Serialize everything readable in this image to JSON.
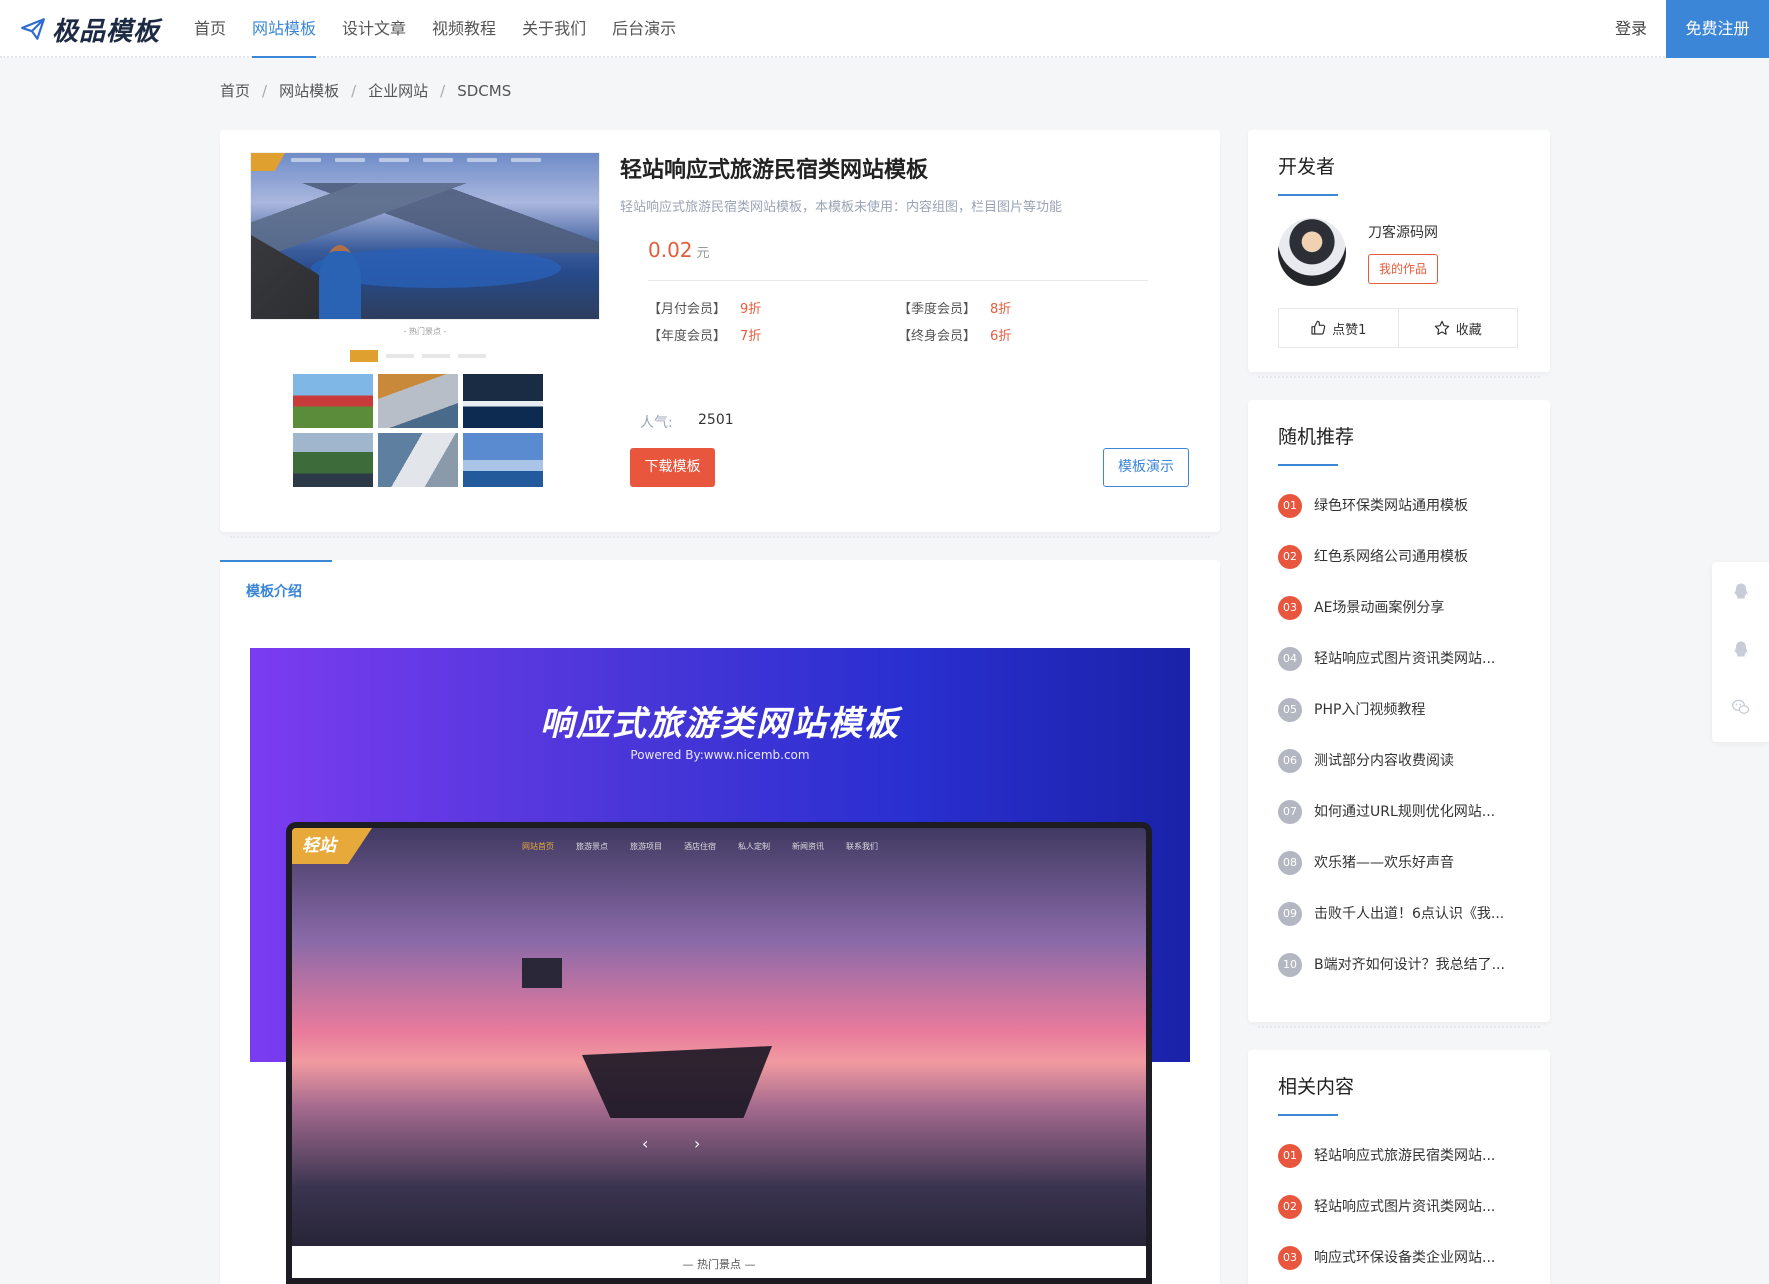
{
  "header": {
    "logo_text": "极品模板",
    "nav": [
      "首页",
      "网站模板",
      "设计文章",
      "视频教程",
      "关于我们",
      "后台演示"
    ],
    "active_index": 1,
    "login": "登录",
    "register": "免费注册"
  },
  "breadcrumb": [
    "首页",
    "网站模板",
    "企业网站",
    "SDCMS"
  ],
  "product": {
    "title": "轻站响应式旅游民宿类网站模板",
    "description": "轻站响应式旅游民宿类网站模板，本模板未使用：内容组图，栏目图片等功能",
    "price": "0.02",
    "currency": "元",
    "members": [
      {
        "name": "【月付会员】",
        "discount": "9折"
      },
      {
        "name": "【季度会员】",
        "discount": "8折"
      },
      {
        "name": "【年度会员】",
        "discount": "7折"
      },
      {
        "name": "【终身会员】",
        "discount": "6折"
      }
    ],
    "popularity_label": "人气:",
    "popularity_value": "2501",
    "download_button": "下载模板",
    "demo_button": "模板演示",
    "preview_caption": "- 热门景点 -"
  },
  "intro": {
    "tab": "模板介绍",
    "banner_title": "响应式旅游类网站模板",
    "banner_sub": "Powered By:www.nicemb.com",
    "screen_logo": "轻站",
    "screen_nav": [
      "网站首页",
      "旅游景点",
      "旅游项目",
      "酒店住宿",
      "私人定制",
      "新闻资讯",
      "联系我们"
    ],
    "screen_caption": "— 热门景点 —"
  },
  "developer": {
    "title": "开发者",
    "name": "刀客源码网",
    "works_button": "我的作品",
    "like_label": "点赞1",
    "collect_label": "收藏"
  },
  "random": {
    "title": "随机推荐",
    "items": [
      {
        "num": "01",
        "text": "绿色环保类网站通用模板"
      },
      {
        "num": "02",
        "text": "红色系网络公司通用模板"
      },
      {
        "num": "03",
        "text": "AE场景动画案例分享"
      },
      {
        "num": "04",
        "text": "轻站响应式图片资讯类网站..."
      },
      {
        "num": "05",
        "text": "PHP入门视频教程"
      },
      {
        "num": "06",
        "text": "测试部分内容收费阅读"
      },
      {
        "num": "07",
        "text": "如何通过URL规则优化网站..."
      },
      {
        "num": "08",
        "text": "欢乐猪——欢乐好声音"
      },
      {
        "num": "09",
        "text": "击败千人出道！6点认识《我..."
      },
      {
        "num": "10",
        "text": "B端对齐如何设计？我总结了..."
      }
    ]
  },
  "related": {
    "title": "相关内容",
    "items": [
      {
        "num": "01",
        "text": "轻站响应式旅游民宿类网站..."
      },
      {
        "num": "02",
        "text": "轻站响应式图片资讯类网站..."
      },
      {
        "num": "03",
        "text": "响应式环保设备类企业网站..."
      }
    ]
  },
  "colors": {
    "accent": "#3b86d6",
    "highlight": "#e8563e"
  }
}
